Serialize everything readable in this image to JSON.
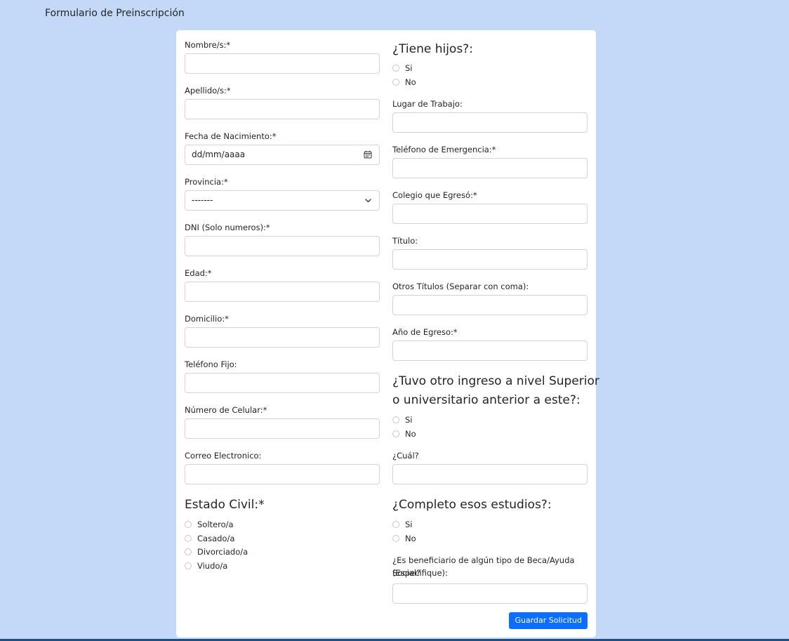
{
  "page_title": "Formulario de Preinscripción",
  "colors": {
    "background": "#c3d9f7",
    "card": "#ffffff",
    "accent": "#0d6efd",
    "bottom_bar": "#1d4f86"
  },
  "left": {
    "nombre": {
      "label": "Nombre/s:*",
      "value": ""
    },
    "apellido": {
      "label": "Apellido/s:*",
      "value": ""
    },
    "fecha": {
      "label": "Fecha de Nacimiento:*",
      "placeholder": "dd/mm/aaaa"
    },
    "provincia": {
      "label": "Provincia:*",
      "selected": "-------"
    },
    "dni": {
      "label": "DNI (Solo numeros):*",
      "value": ""
    },
    "edad": {
      "label": "Edad:*",
      "value": ""
    },
    "domicilio": {
      "label": "Domicilio:*",
      "value": ""
    },
    "telefono_fijo": {
      "label": "Teléfono Fijo:",
      "value": ""
    },
    "celular": {
      "label": "Número de Celular:*",
      "value": ""
    },
    "correo": {
      "label": "Correo Electronico:",
      "value": ""
    },
    "estado_civil": {
      "title": "Estado Civil:*",
      "options": [
        "Soltero/a",
        "Casado/a",
        "Divorciado/a",
        "Viudo/a"
      ]
    }
  },
  "right": {
    "hijos": {
      "title": "¿Tiene hijos?:",
      "options": [
        "Si",
        "No"
      ]
    },
    "lugar_trabajo": {
      "label": "Lugar de Trabajo:",
      "value": ""
    },
    "tel_emergencia": {
      "label": "Teléfono de Emergencia:*",
      "value": ""
    },
    "colegio": {
      "label": "Colegio que Egresó:*",
      "value": ""
    },
    "titulo": {
      "label": "Título:",
      "value": ""
    },
    "otros_titulos": {
      "label": "Otros Títulos (Separar con coma):",
      "value": ""
    },
    "anio_egreso": {
      "label": "Año de Egreso:*",
      "value": ""
    },
    "otro_ingreso": {
      "title_line1": "¿Tuvo otro ingreso a nivel Superior",
      "title_line2": "o universitario anterior a este?:",
      "options": [
        "Si",
        "No"
      ]
    },
    "cual": {
      "label": "¿Cuál?",
      "value": ""
    },
    "completo": {
      "title": "¿Completo esos estudios?:",
      "options": [
        "Si",
        "No"
      ]
    },
    "beca": {
      "label_line1": "¿Es beneficiario de algún tipo de Beca/Ayuda Social?",
      "label_line2": "(Especifique):",
      "value": ""
    },
    "save_label": "Guardar Solicitud"
  }
}
